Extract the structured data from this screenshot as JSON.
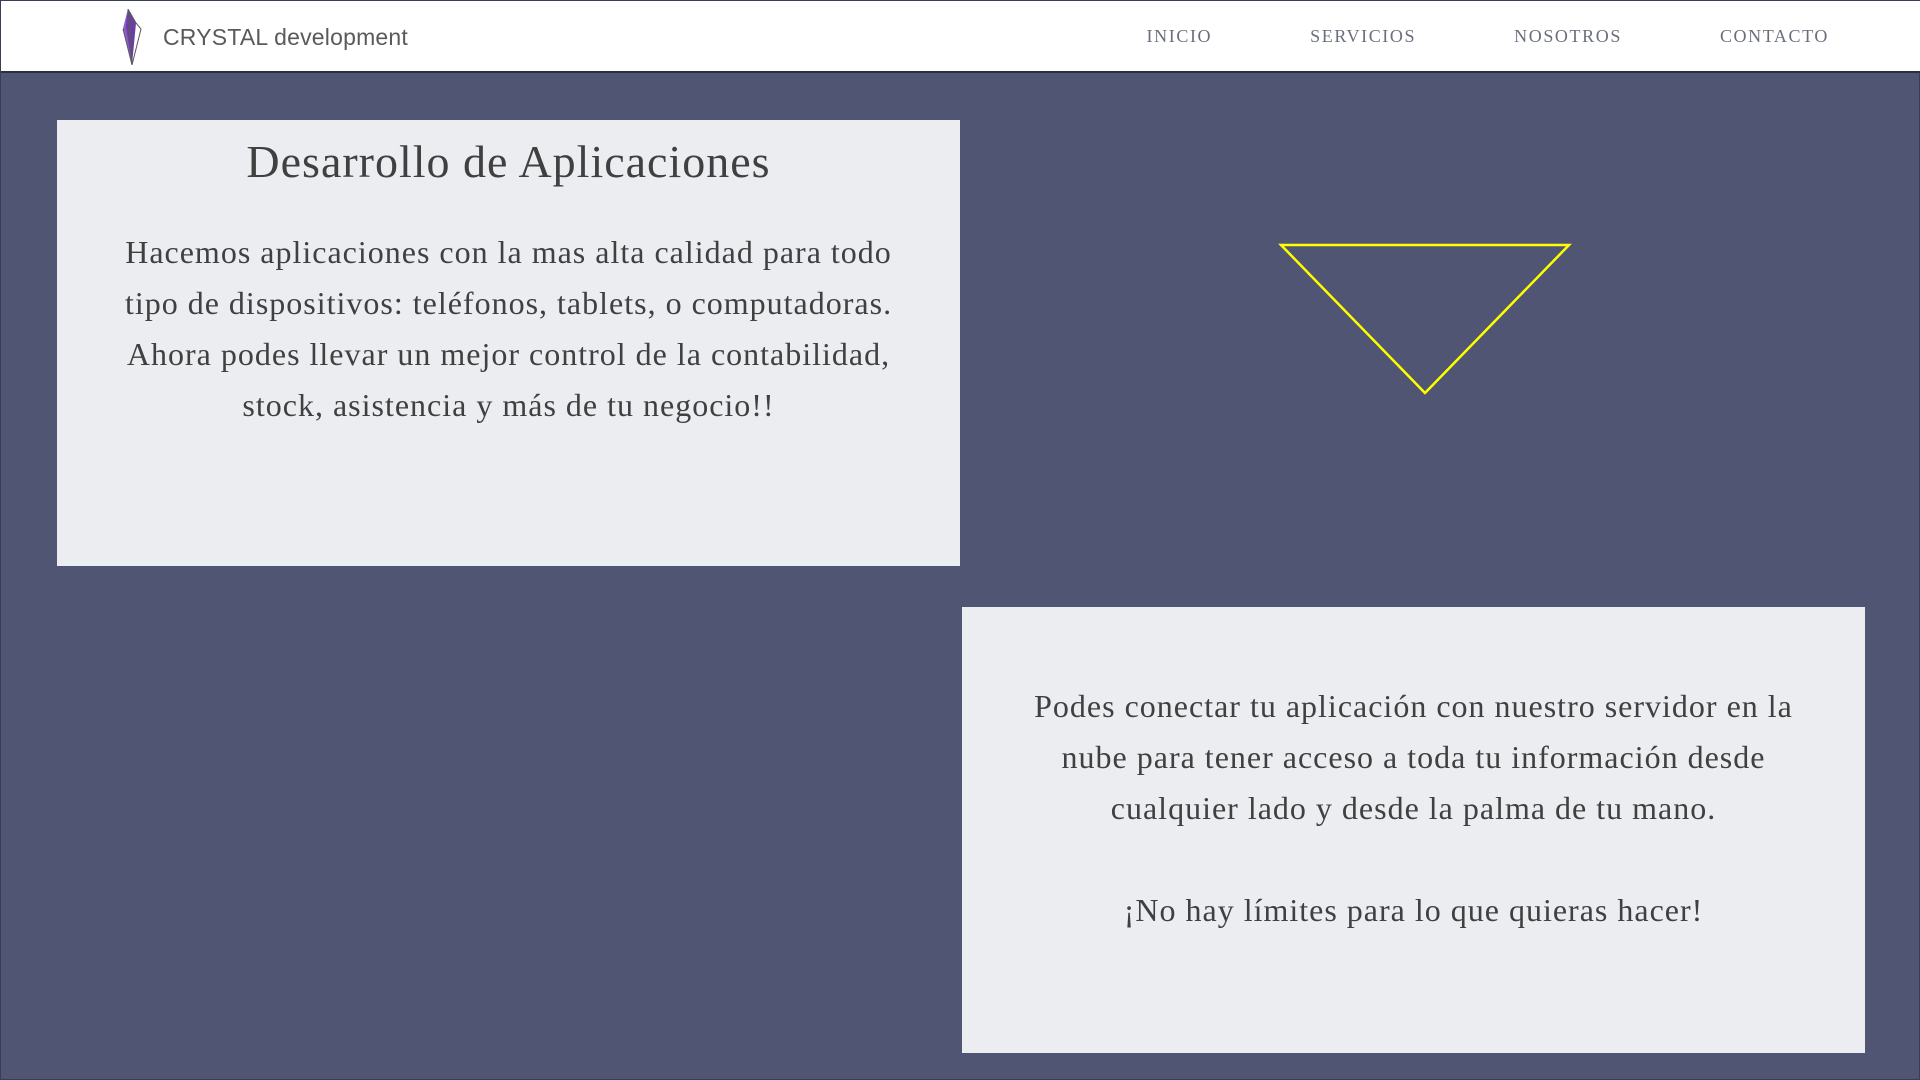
{
  "header": {
    "brand_name": "CRYSTAL development",
    "nav": [
      "INICIO",
      "SERVICIOS",
      "NOSOTROS",
      "CONTACTO"
    ]
  },
  "section_apps": {
    "title": "Desarrollo de Aplicaciones",
    "paragraph_1": "Hacemos aplicaciones con la mas alta calidad para todo tipo de dispositivos: teléfonos, tablets, o computadoras.",
    "paragraph_2": "Ahora podes llevar un mejor control de la contabilidad, stock, asistencia y más de tu negocio!!"
  },
  "section_cloud": {
    "paragraph_1": "Podes conectar tu aplicación con nuestro servidor en la nube para tener acceso a toda tu información desde cualquier lado y desde la palma de tu mano.",
    "paragraph_2": "¡No hay límites para lo que quieras hacer!"
  },
  "colors": {
    "background": "#4f5572",
    "card": "#ecedf1",
    "accent_triangle": "#ffff00",
    "logo": "#6a3fa0"
  },
  "icons": {
    "logo": "crystal-logo-icon",
    "decoration": "triangle-outline-icon"
  }
}
